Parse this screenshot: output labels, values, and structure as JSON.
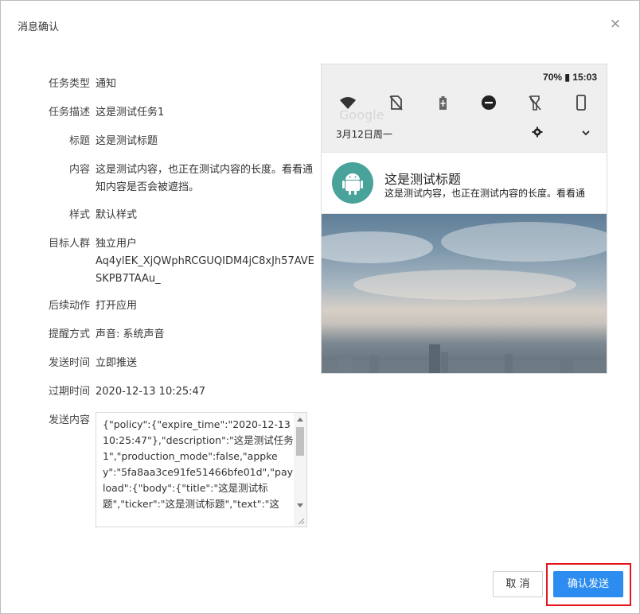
{
  "dialog": {
    "title": "消息确认",
    "close_icon": "×"
  },
  "fields": [
    {
      "label": "任务类型",
      "value": "通知"
    },
    {
      "label": "任务描述",
      "value": "这是测试任务1"
    },
    {
      "label": "标题",
      "value": "这是测试标题"
    },
    {
      "label": "内容",
      "value": "这是测试内容，也正在测试内容的长度。看看通知内容是否会被遮挡。"
    },
    {
      "label": "样式",
      "value": "默认样式"
    },
    {
      "label": "目标人群",
      "value": "独立用户"
    },
    {
      "label": "",
      "value": "Aq4ylEK_XjQWphRCGUQIDM4jC8xJh57AVESKPB7TAAu_"
    },
    {
      "label": "后续动作",
      "value": "打开应用"
    },
    {
      "label": "提醒方式",
      "value": "声音: 系统声音"
    },
    {
      "label": "发送时间",
      "value": "立即推送"
    },
    {
      "label": "过期时间",
      "value": "2020-12-13 10:25:47"
    }
  ],
  "payload": {
    "label": "发送内容",
    "text": "{\"policy\":{\"expire_time\":\"2020-12-13 10:25:47\"},\"description\":\"这是测试任务1\",\"production_mode\":false,\"appkey\":\"5fa8aa3ce91fe51466bfe01d\",\"payload\":{\"body\":{\"title\":\"这是测试标题\",\"ticker\":\"这是测试标题\",\"text\":\"这"
  },
  "preview": {
    "status_text": "70% ▮ 15:03",
    "ghost_search": "Google",
    "date": "3月12日周一",
    "notification_title": "这是测试标题",
    "notification_text": "这是测试内容，也正在测试内容的长度。看看通",
    "quick_icons": [
      "wifi-icon",
      "sim-icon",
      "battery-icon",
      "do-not-disturb-icon",
      "flashlight-icon",
      "phone-icon"
    ]
  },
  "buttons": {
    "cancel": "取 消",
    "confirm": "确认发送"
  },
  "colors": {
    "primary": "#2d8cf0",
    "highlight": "#e8141c",
    "android_avatar": "#4aa39a"
  }
}
